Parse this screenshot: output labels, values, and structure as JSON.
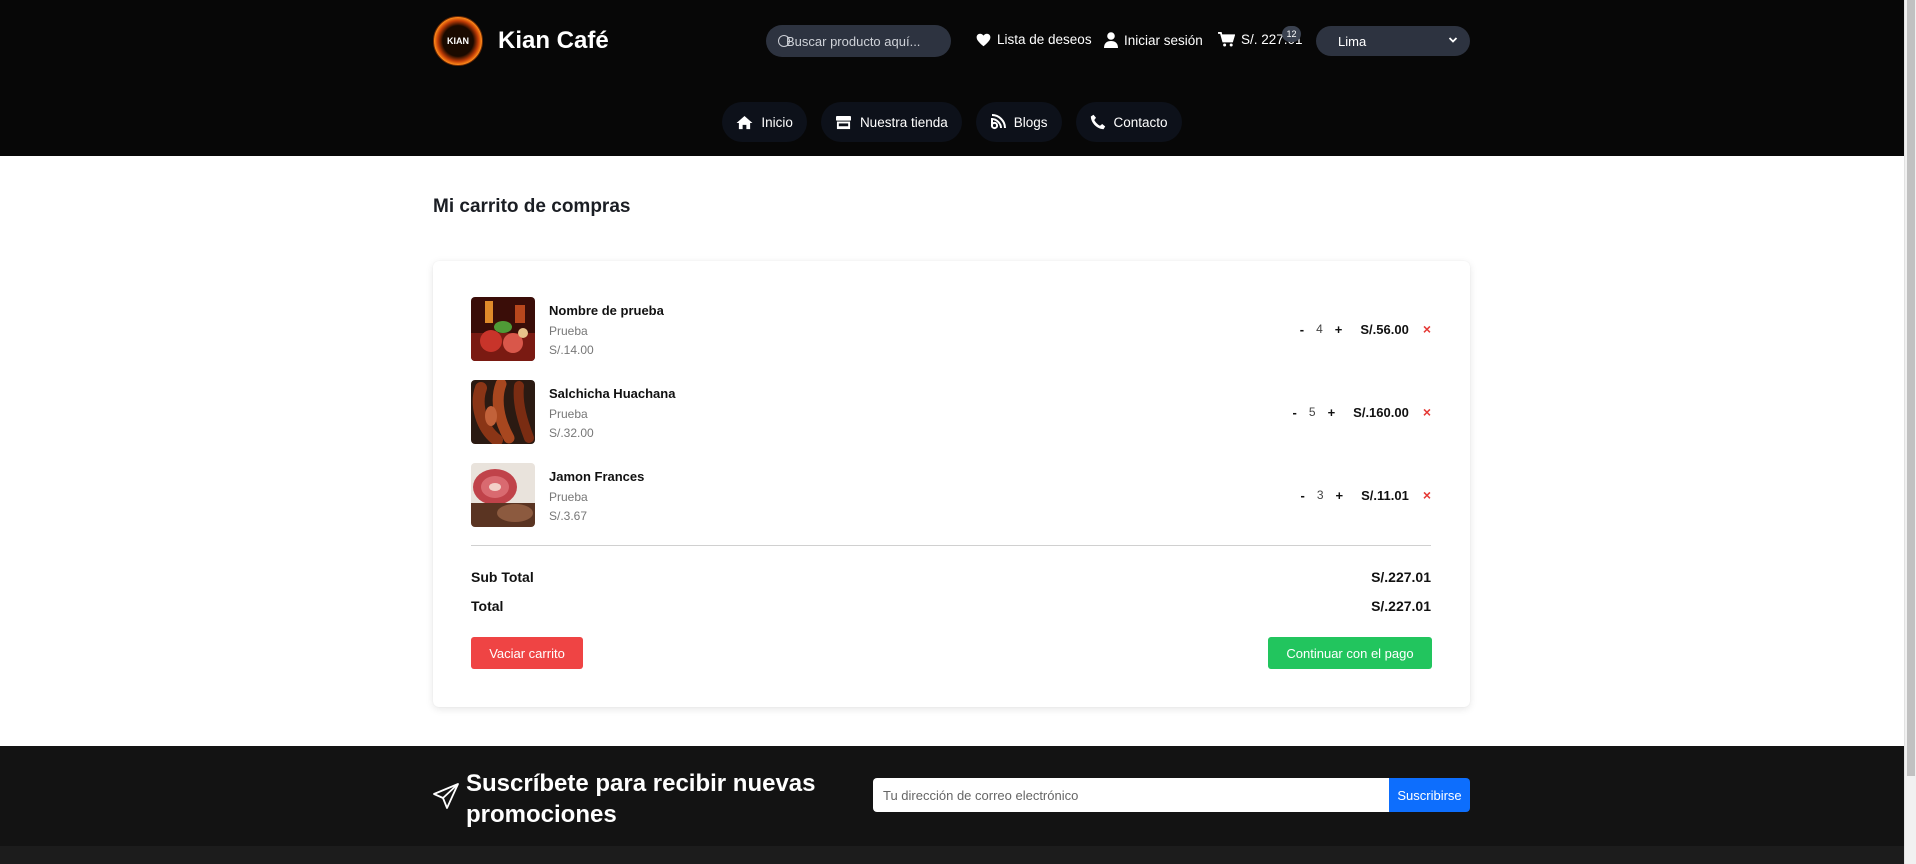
{
  "header": {
    "logo_text": "KIAN",
    "brand": "Kian Café",
    "search_placeholder": "Buscar producto aquí...",
    "wishlist_label": "Lista de deseos",
    "login_label": "Iniciar sesión",
    "cart_total": "S/. 227.01",
    "cart_count": "12",
    "city": "Lima",
    "nav": [
      {
        "label": "Inicio"
      },
      {
        "label": "Nuestra tienda"
      },
      {
        "label": "Blogs"
      },
      {
        "label": "Contacto"
      }
    ]
  },
  "cart": {
    "title": "Mi carrito de compras",
    "items": [
      {
        "name": "Nombre de prueba",
        "category": "Prueba",
        "unit_price": "S/.14.00",
        "qty": "4",
        "line_total": "S/.56.00",
        "image": "meat-platter"
      },
      {
        "name": "Salchicha Huachana",
        "category": "Prueba",
        "unit_price": "S/.32.00",
        "qty": "5",
        "line_total": "S/.160.00",
        "image": "sausage"
      },
      {
        "name": "Jamon Frances",
        "category": "Prueba",
        "unit_price": "S/.3.67",
        "qty": "3",
        "line_total": "S/.11.01",
        "image": "ham"
      }
    ],
    "minus": "-",
    "plus": "+",
    "remove": "×",
    "subtotal_label": "Sub Total",
    "subtotal_value": "S/.227.01",
    "total_label": "Total",
    "total_value": "S/.227.01",
    "clear_button": "Vaciar carrito",
    "pay_button": "Continuar con el pago"
  },
  "footer": {
    "subscribe_title": "Suscríbete para recibir nuevas promociones",
    "email_placeholder": "Tu dirección de correo electrónico",
    "subscribe_button": "Suscribirse"
  },
  "colors": {
    "header_bg": "#070707",
    "danger": "#ef4444",
    "success": "#22c55e",
    "primary": "#0d6efd"
  }
}
